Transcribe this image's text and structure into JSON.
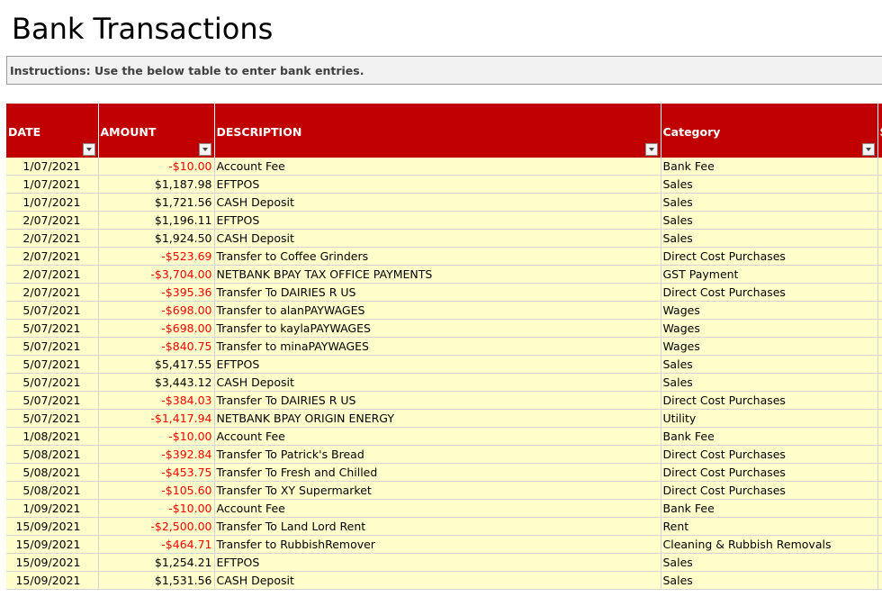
{
  "title": "Bank Transactions",
  "instructions": "Instructions: Use the below table to enter bank entries.",
  "columns": [
    "DATE",
    "AMOUNT",
    "DESCRIPTION",
    "Category",
    "S"
  ],
  "rows": [
    {
      "date": "1/07/2021",
      "amount": "-$10.00",
      "desc": "Account Fee",
      "cat": "Bank Fee"
    },
    {
      "date": "1/07/2021",
      "amount": "$1,187.98",
      "desc": "EFTPOS",
      "cat": "Sales"
    },
    {
      "date": "1/07/2021",
      "amount": "$1,721.56",
      "desc": "CASH Deposit",
      "cat": "Sales"
    },
    {
      "date": "2/07/2021",
      "amount": "$1,196.11",
      "desc": "EFTPOS",
      "cat": "Sales"
    },
    {
      "date": "2/07/2021",
      "amount": "$1,924.50",
      "desc": "CASH Deposit",
      "cat": "Sales"
    },
    {
      "date": "2/07/2021",
      "amount": "-$523.69",
      "desc": "Transfer to Coffee Grinders",
      "cat": "Direct Cost Purchases"
    },
    {
      "date": "2/07/2021",
      "amount": "-$3,704.00",
      "desc": "NETBANK BPAY TAX OFFICE PAYMENTS",
      "cat": "GST Payment"
    },
    {
      "date": "2/07/2021",
      "amount": "-$395.36",
      "desc": "Transfer To DAIRIES R US",
      "cat": "Direct Cost Purchases"
    },
    {
      "date": "5/07/2021",
      "amount": "-$698.00",
      "desc": "Transfer to alanPAYWAGES",
      "cat": "Wages"
    },
    {
      "date": "5/07/2021",
      "amount": "-$698.00",
      "desc": "Transfer to kaylaPAYWAGES",
      "cat": "Wages"
    },
    {
      "date": "5/07/2021",
      "amount": "-$840.75",
      "desc": "Transfer to minaPAYWAGES",
      "cat": "Wages"
    },
    {
      "date": "5/07/2021",
      "amount": "$5,417.55",
      "desc": "EFTPOS",
      "cat": "Sales"
    },
    {
      "date": "5/07/2021",
      "amount": "$3,443.12",
      "desc": "CASH Deposit",
      "cat": "Sales"
    },
    {
      "date": "5/07/2021",
      "amount": "-$384.03",
      "desc": "Transfer To DAIRIES R US",
      "cat": "Direct Cost Purchases"
    },
    {
      "date": "5/07/2021",
      "amount": "-$1,417.94",
      "desc": "NETBANK BPAY ORIGIN ENERGY",
      "cat": "Utility"
    },
    {
      "date": "1/08/2021",
      "amount": "-$10.00",
      "desc": "Account Fee",
      "cat": "Bank Fee"
    },
    {
      "date": "5/08/2021",
      "amount": "-$392.84",
      "desc": "Transfer To Patrick's Bread",
      "cat": "Direct Cost Purchases"
    },
    {
      "date": "5/08/2021",
      "amount": "-$453.75",
      "desc": "Transfer To Fresh and Chilled",
      "cat": "Direct Cost Purchases"
    },
    {
      "date": "5/08/2021",
      "amount": "-$105.60",
      "desc": "Transfer To  XY Supermarket",
      "cat": "Direct Cost Purchases"
    },
    {
      "date": "1/09/2021",
      "amount": "-$10.00",
      "desc": "Account Fee",
      "cat": "Bank Fee"
    },
    {
      "date": "15/09/2021",
      "amount": "-$2,500.00",
      "desc": "Transfer To Land Lord Rent",
      "cat": "Rent"
    },
    {
      "date": "15/09/2021",
      "amount": "-$464.71",
      "desc": "Transfer to RubbishRemover",
      "cat": "Cleaning & Rubbish Removals"
    },
    {
      "date": "15/09/2021",
      "amount": "$1,254.21",
      "desc": "EFTPOS",
      "cat": "Sales"
    },
    {
      "date": "15/09/2021",
      "amount": "$1,531.56",
      "desc": "CASH Deposit",
      "cat": "Sales"
    }
  ],
  "colors": {
    "header_bg": "#c00000",
    "row_bg": "#ffffcc",
    "negative": "#ff0000"
  }
}
